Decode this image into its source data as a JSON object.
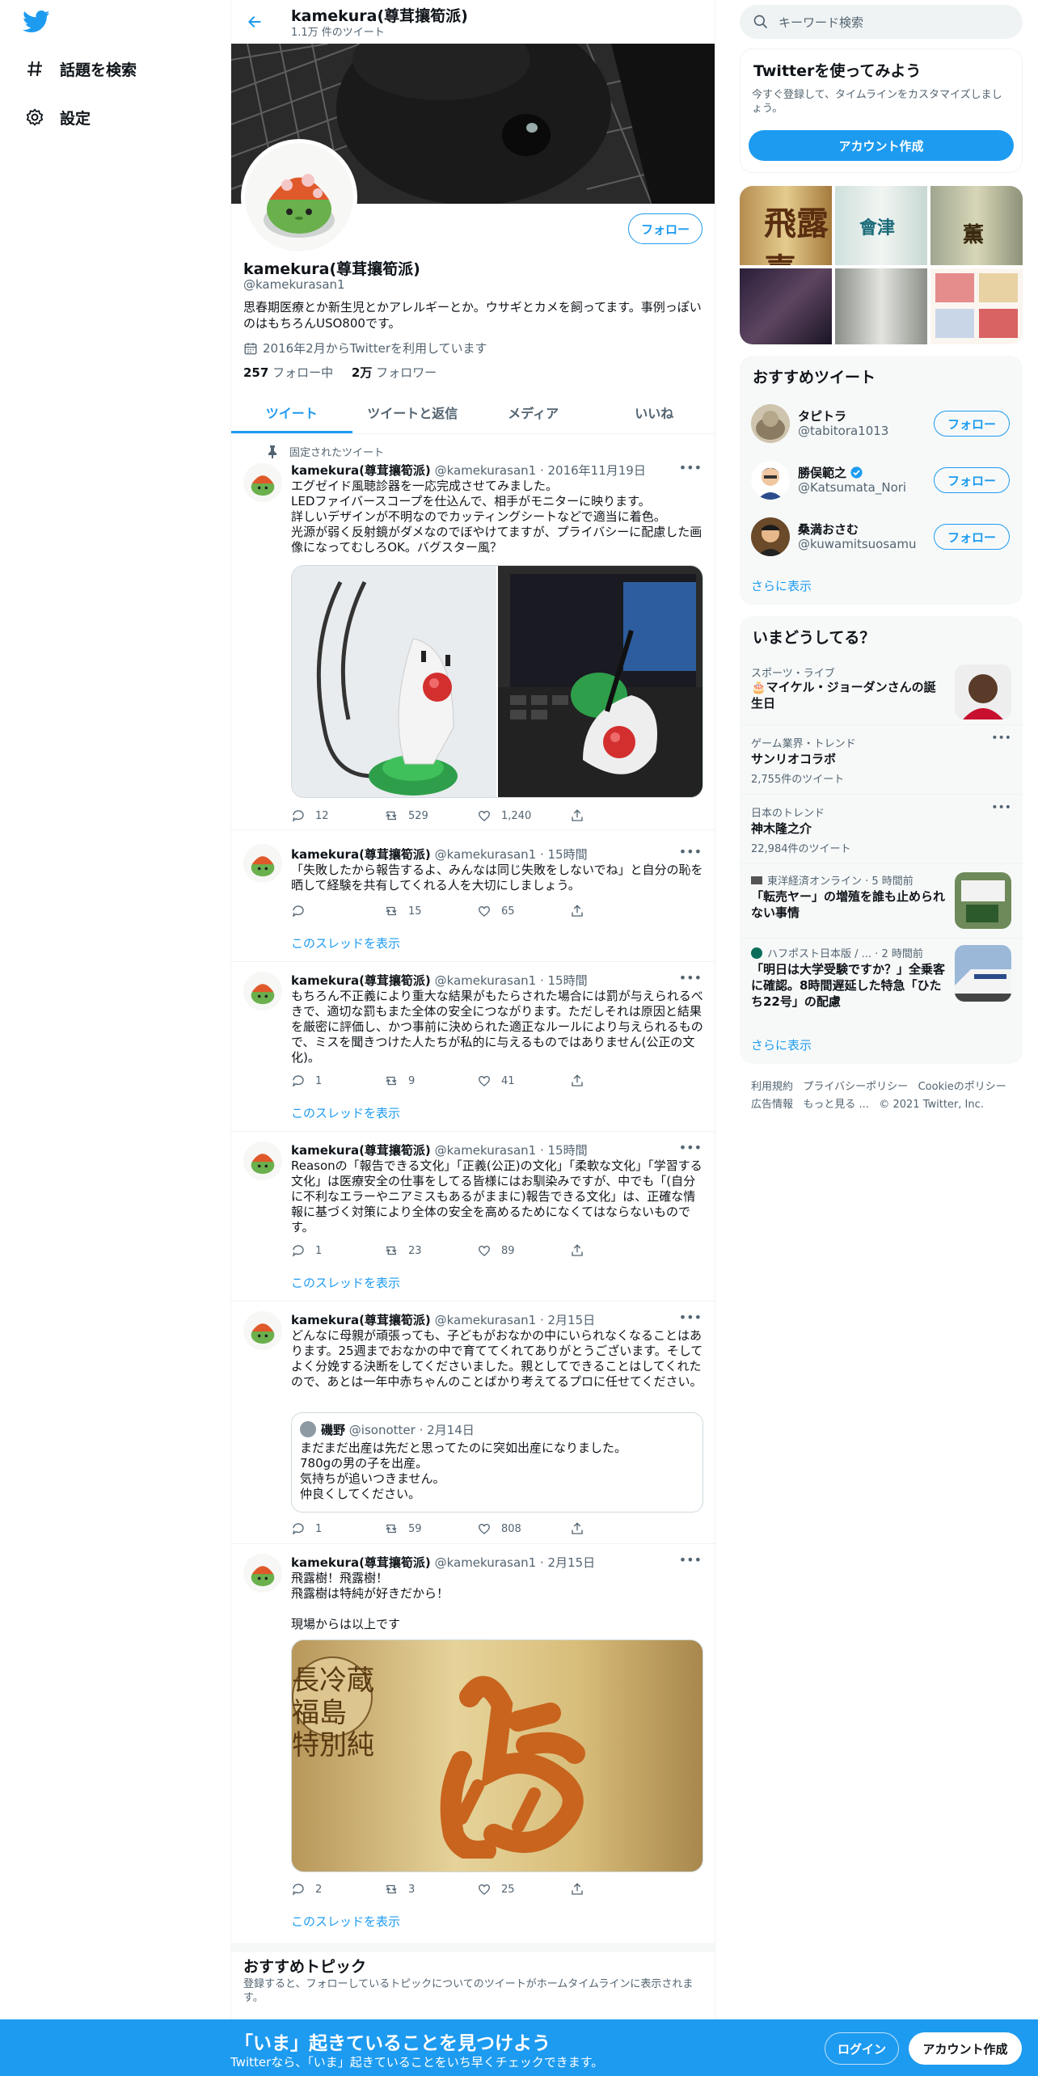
{
  "colors": {
    "accent": "#1d9bf0",
    "text": "#0f1419",
    "muted": "#536471"
  },
  "nav": {
    "logo_icon": "twitter-bird-icon",
    "items": [
      {
        "icon": "hashtag-icon",
        "label": "話題を検索"
      },
      {
        "icon": "gear-icon",
        "label": "設定"
      }
    ]
  },
  "header": {
    "name": "kamekura(尊茸攘筍派)",
    "tweet_count": "1.1万 件のツイート"
  },
  "profile": {
    "follow_label": "フォロー",
    "name": "kamekura(尊茸攘筍派)",
    "handle": "@kamekurasan1",
    "bio": "思春期医療とか新生児とかアレルギーとか。ウサギとカメを飼ってます。事例っぽいのはもちろんUSO800です。",
    "joined": "2016年2月からTwitterを利用しています",
    "following_count": "257",
    "following_label": "フォロー中",
    "followers_count": "2万",
    "followers_label": "フォロワー"
  },
  "tabs": [
    {
      "label": "ツイート",
      "active": true
    },
    {
      "label": "ツイートと返信",
      "active": false
    },
    {
      "label": "メディア",
      "active": false
    },
    {
      "label": "いいね",
      "active": false
    }
  ],
  "pinned_label": "固定されたツイート",
  "show_thread_label": "このスレッドを表示",
  "tweets": [
    {
      "name": "kamekura(尊茸攘筍派)",
      "handle": "@kamekurasan1",
      "time": "2016年11月19日",
      "text": "エグゼイド風聴診器を一応完成させてみました。\nLEDファイバースコープを仕込んで、相手がモニターに映ります。\n詳しいデザインが不明なのでカッティングシートなどで適当に着色。\n光源が弱く反射鏡がダメなのでぼやけてますが、プライバシーに配慮した画像になってむしろOK。バグスター風？",
      "replies": "12",
      "retweets": "529",
      "likes": "1,240"
    },
    {
      "name": "kamekura(尊茸攘筍派)",
      "handle": "@kamekurasan1",
      "time": "15時間",
      "text": "「失敗したから報告するよ、みんなは同じ失敗をしないでね」と自分の恥を晒して経験を共有してくれる人を大切にしましょう。",
      "replies": "",
      "retweets": "15",
      "likes": "65"
    },
    {
      "name": "kamekura(尊茸攘筍派)",
      "handle": "@kamekurasan1",
      "time": "15時間",
      "text": "もちろん不正義により重大な結果がもたらされた場合には罰が与えられるべきで、適切な罰もまた全体の安全につながります。ただしそれは原因と結果を厳密に評価し、かつ事前に決められた適正なルールにより与えられるもので、ミスを聞きつけた人たちが私的に与えるものではありません(公正の文化)。",
      "replies": "1",
      "retweets": "9",
      "likes": "41"
    },
    {
      "name": "kamekura(尊茸攘筍派)",
      "handle": "@kamekurasan1",
      "time": "15時間",
      "text": "Reasonの「報告できる文化」「正義(公正)の文化」「柔軟な文化」「学習する文化」は医療安全の仕事をしてる皆様にはお馴染みですが、中でも「(自分に不利なエラーやニアミスもあるがままに)報告できる文化」は、正確な情報に基づく対策により全体の安全を高めるためになくてはならないものです。",
      "replies": "1",
      "retweets": "23",
      "likes": "89"
    },
    {
      "name": "kamekura(尊茸攘筍派)",
      "handle": "@kamekurasan1",
      "time": "2月15日",
      "text": "どんなに母親が頑張っても、子どもがおなかの中にいられなくなることはあります。25週までおなかの中で育ててくれてありがとうございます。そしてよく分娩する決断をしてくださいました。親としてできることはしてくれたので、あとは一年中赤ちゃんのことばかり考えてるプロに任せてください。",
      "replies": "1",
      "retweets": "59",
      "likes": "808",
      "quote": {
        "name": "磯野",
        "handle": "@isonotter",
        "time": "2月14日",
        "text": "まだまだ出産は先だと思ってたのに突如出産になりました。\n780gの男の子を出産。\n気持ちが追いつきません。\n仲良くしてください。"
      }
    },
    {
      "name": "kamekura(尊茸攘筍派)",
      "handle": "@kamekurasan1",
      "time": "2月15日",
      "text": "飛露樹！飛露樹！\n飛露樹は特純が好きだから！\n\n現場からは以上です",
      "replies": "2",
      "retweets": "3",
      "likes": "25",
      "label_text": "長冷蔵\n福島\n特別純"
    }
  ],
  "topics": {
    "title": "おすすめトピック",
    "desc": "登録すると、フォローしているトピックについてのツイートがホームタイムラインに表示されます。"
  },
  "right": {
    "search_placeholder": "キーワード検索",
    "try": {
      "title": "Twitterを使ってみよう",
      "desc": "今すぐ登録して、タイムラインをカスタマイズしましょう。",
      "button": "アカウント作成"
    },
    "grid_labels": [
      "飛露喜",
      "會津",
      "薫"
    ],
    "who": {
      "title": "おすすめツイート",
      "follow_label": "フォロー",
      "more": "さらに表示",
      "users": [
        {
          "name": "タピトラ",
          "handle": "@tabitora1013",
          "verified": false
        },
        {
          "name": "勝俣範之",
          "handle": "@Katsumata_Nori",
          "verified": true
        },
        {
          "name": "桑満おさむ",
          "handle": "@kuwamitsuosamu",
          "verified": false
        }
      ]
    },
    "trends": {
      "title": "いまどうしてる？",
      "more": "さらに表示",
      "items": [
        {
          "meta": "スポーツ・ライブ",
          "title": "🎂マイケル・ジョーダンさんの誕生日",
          "count": ""
        },
        {
          "meta": "ゲーム業界・トレンド",
          "title": "サンリオコラボ",
          "count": "2,755件のツイート"
        },
        {
          "meta": "日本のトレンド",
          "title": "神木隆之介",
          "count": "22,984件のツイート"
        },
        {
          "meta": "東洋経済オンライン · 5 時間前",
          "title": "「転売ヤー」の増殖を誰も止められない事情",
          "count": ""
        },
        {
          "meta": "ハフポスト日本版 / ... · 2 時間前",
          "title": "「明日は大学受験ですか？」全乗客に確認。8時間遅延した特急「ひたち22号」の配慮",
          "count": ""
        }
      ]
    },
    "footer": {
      "links": [
        "利用規約",
        "プライバシーポリシー",
        "Cookieのポリシー",
        "広告情報",
        "もっと見る ...",
        "© 2021 Twitter, Inc."
      ]
    }
  },
  "bottom": {
    "title": "「いま」起きていることを見つけよう",
    "sub": "Twitterなら、「いま」起きていることをいち早くチェックできます。",
    "login": "ログイン",
    "signup": "アカウント作成"
  }
}
